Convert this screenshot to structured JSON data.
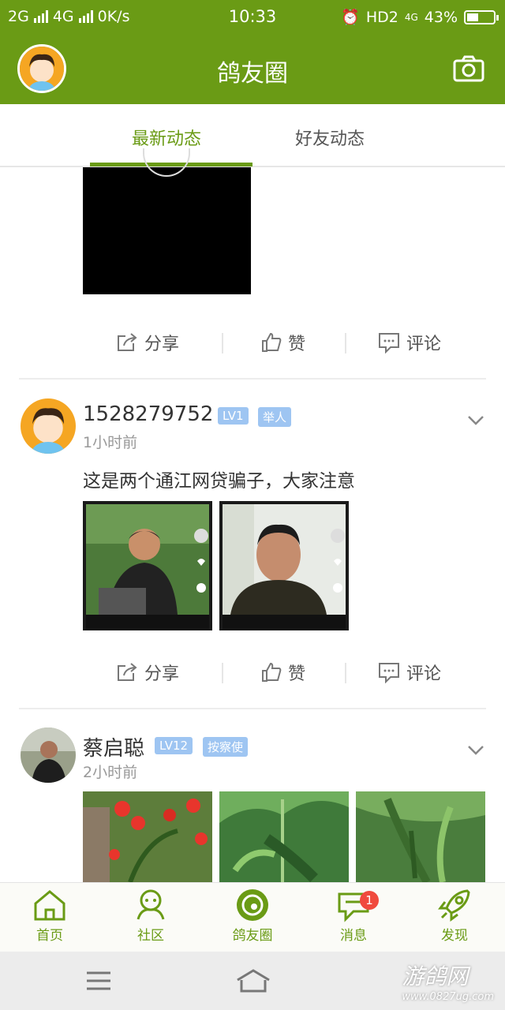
{
  "status_bar": {
    "net1": "2G",
    "net2": "4G",
    "speed": "0K/s",
    "time": "10:33",
    "hd": "HD2",
    "net3": "4G",
    "battery": "43%"
  },
  "app_bar": {
    "title": "鸽友圈",
    "left_icon": "avatar",
    "right_icon": "camera-icon"
  },
  "tabs": [
    {
      "label": "最新动态",
      "active": true
    },
    {
      "label": "好友动态",
      "active": false
    }
  ],
  "actions": {
    "share": "分享",
    "like": "赞",
    "comment": "评论"
  },
  "posts": [
    {
      "user": "1528279752",
      "level": "LV1",
      "title": "举人",
      "time": "1小时前",
      "text": "这是两个通江网贷骗子，大家注意"
    },
    {
      "user": "蔡启聪",
      "level": "LV12",
      "title": "按察使",
      "time": "2小时前",
      "text": ""
    }
  ],
  "bottom_nav": [
    {
      "label": "首页",
      "icon": "home-icon"
    },
    {
      "label": "社区",
      "icon": "community-icon"
    },
    {
      "label": "鸽友圈",
      "icon": "pigeon-circle-icon"
    },
    {
      "label": "消息",
      "icon": "message-icon",
      "badge": "1"
    },
    {
      "label": "发现",
      "icon": "rocket-icon"
    }
  ],
  "watermark": {
    "title": "游鸽网",
    "url": "www.0827ug.com"
  },
  "colors": {
    "brand": "#6a9b15",
    "badge": "#9ec5f2",
    "notify": "#f04a3e"
  }
}
